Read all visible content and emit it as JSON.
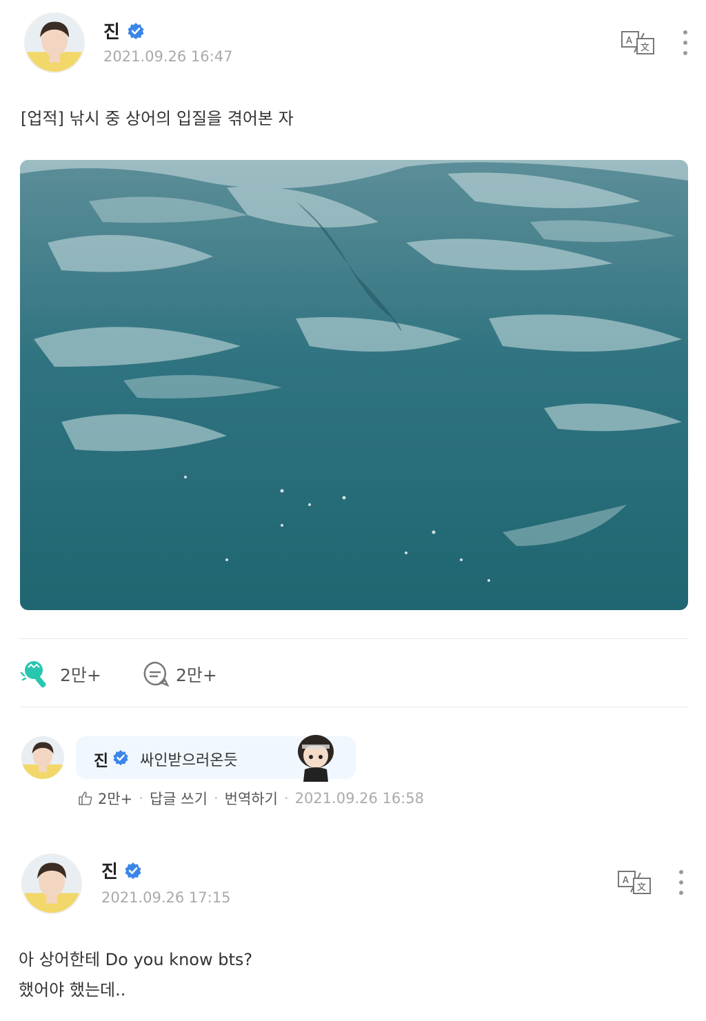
{
  "post1": {
    "author": "진",
    "timestamp": "2021.09.26 16:47",
    "text": "[업적] 낚시 중 상어의 입질을 겪어본 자",
    "likes": "2만+",
    "comments": "2만+"
  },
  "comment": {
    "author": "진",
    "text": "싸인받으러온듯",
    "likes": "2만+",
    "reply_label": "답글 쓰기",
    "translate_label": "번역하기",
    "timestamp": "2021.09.26 16:58",
    "separator": "·"
  },
  "post2": {
    "author": "진",
    "timestamp": "2021.09.26 17:15",
    "text_line1": "아 상어한테 Do you know bts?",
    "text_line2": "했어야 했는데.."
  },
  "colors": {
    "verified": "#3a86e8",
    "accent_green": "#28c7b0",
    "date_gray": "#a9a9a9",
    "bubble_bg": "#f1f7ff",
    "water": "#2a6e7e"
  },
  "icons": {
    "verified": "verified-badge-icon",
    "translate": "translate-icon",
    "more": "more-vertical-icon",
    "cheer": "lightstick-cheer-icon",
    "comment": "comment-bubble-icon",
    "like": "thumbs-up-icon"
  }
}
